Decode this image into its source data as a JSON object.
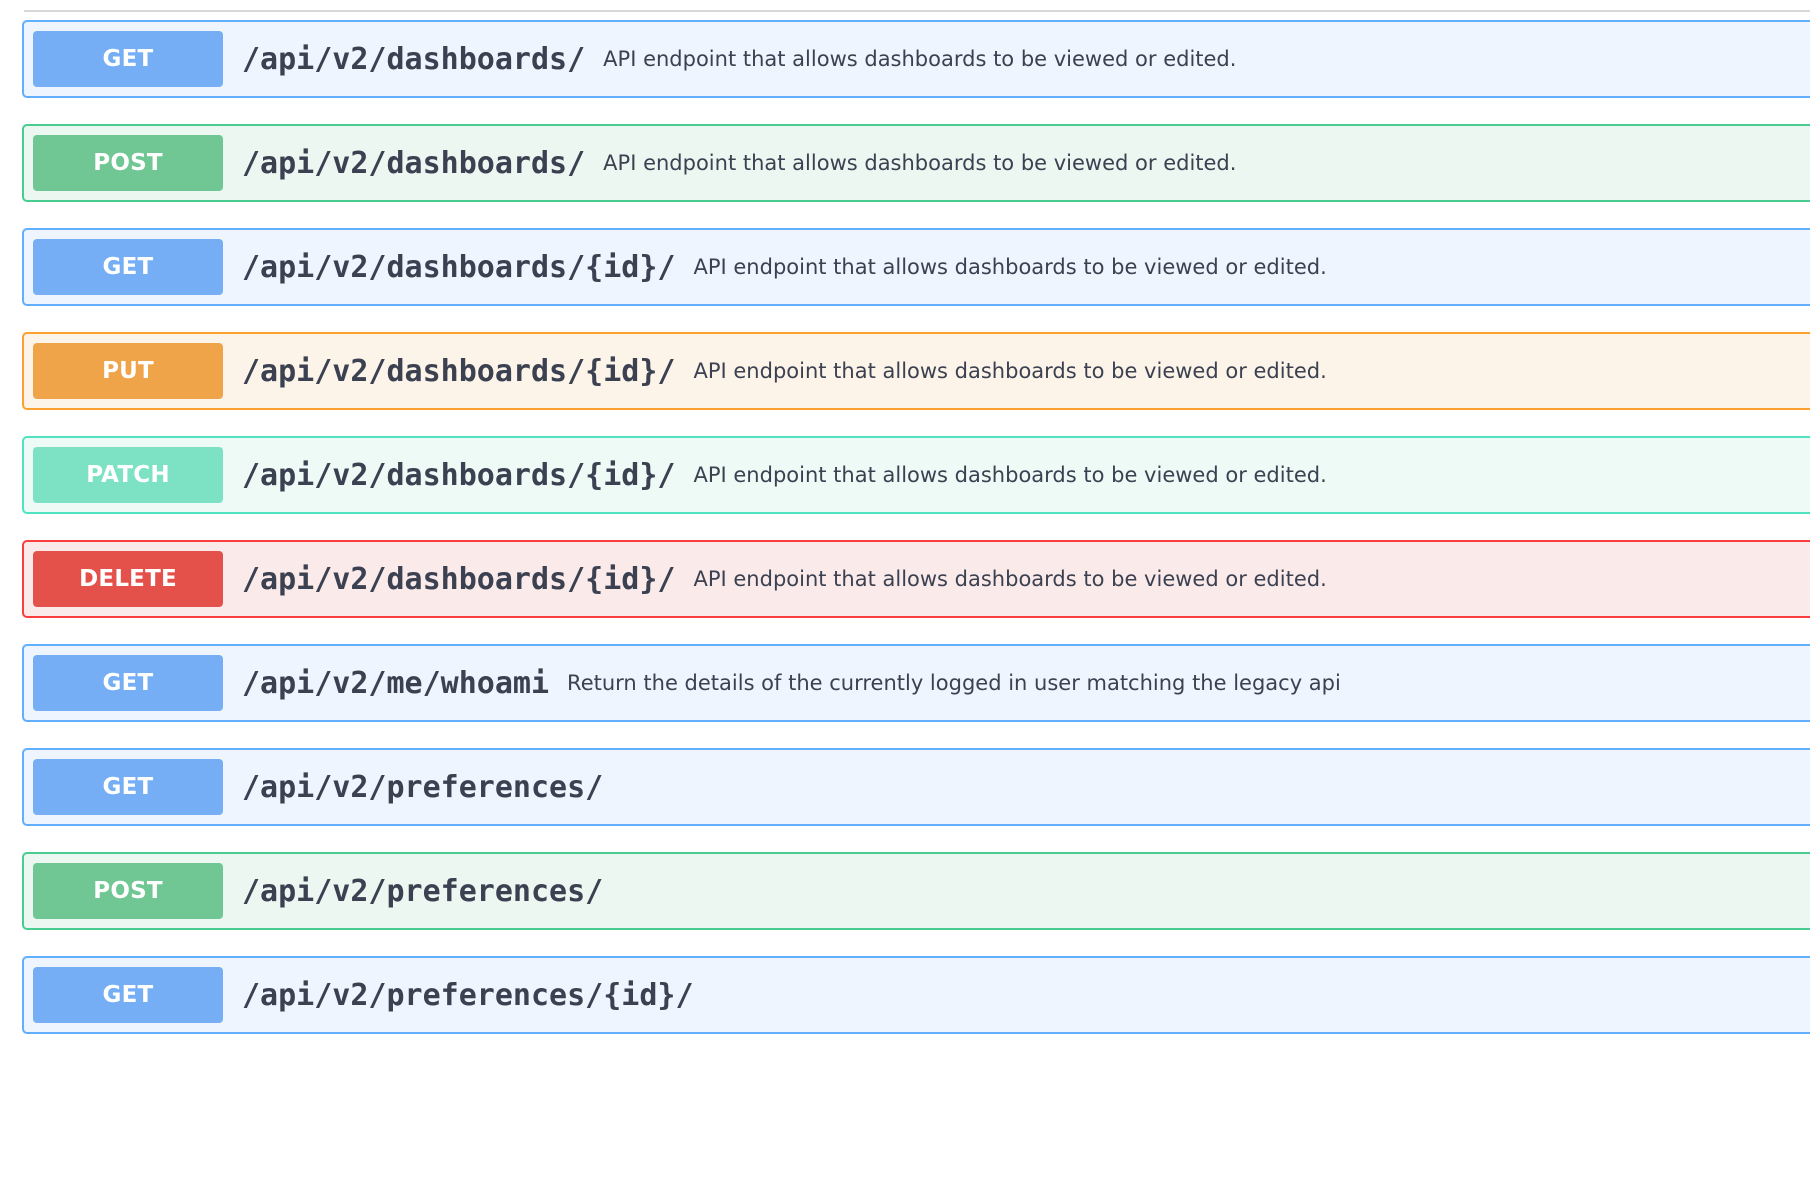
{
  "operations": [
    {
      "method": "GET",
      "path": "/api/v2/dashboards/",
      "description": "API endpoint that allows dashboards to be viewed or edited."
    },
    {
      "method": "POST",
      "path": "/api/v2/dashboards/",
      "description": "API endpoint that allows dashboards to be viewed or edited."
    },
    {
      "method": "GET",
      "path": "/api/v2/dashboards/{id}/",
      "description": "API endpoint that allows dashboards to be viewed or edited."
    },
    {
      "method": "PUT",
      "path": "/api/v2/dashboards/{id}/",
      "description": "API endpoint that allows dashboards to be viewed or edited."
    },
    {
      "method": "PATCH",
      "path": "/api/v2/dashboards/{id}/",
      "description": "API endpoint that allows dashboards to be viewed or edited."
    },
    {
      "method": "DELETE",
      "path": "/api/v2/dashboards/{id}/",
      "description": "API endpoint that allows dashboards to be viewed or edited."
    },
    {
      "method": "GET",
      "path": "/api/v2/me/whoami",
      "description": "Return the details of the currently logged in user matching the legacy api"
    },
    {
      "method": "GET",
      "path": "/api/v2/preferences/",
      "description": ""
    },
    {
      "method": "POST",
      "path": "/api/v2/preferences/",
      "description": ""
    },
    {
      "method": "GET",
      "path": "/api/v2/preferences/{id}/",
      "description": ""
    }
  ],
  "colors": {
    "get": "#61affe",
    "post": "#49cc90",
    "put": "#fca130",
    "patch": "#50e3c2",
    "delete": "#f93e3e"
  }
}
